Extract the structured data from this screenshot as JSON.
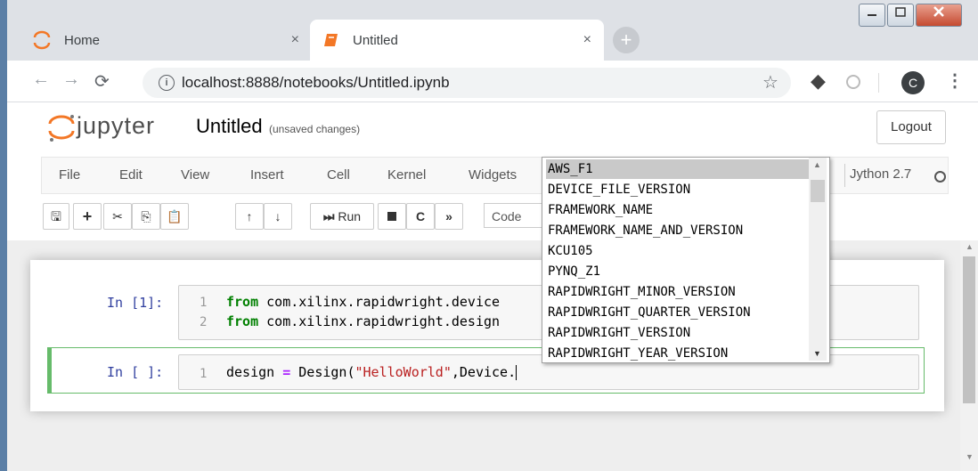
{
  "browser": {
    "tabs": [
      {
        "label": "Home",
        "close": "×"
      },
      {
        "label": "Untitled",
        "close": "×"
      }
    ],
    "new_tab": "+",
    "url": "localhost:8888/notebooks/Untitled.ipynb",
    "profile_initial": "C"
  },
  "jupyter": {
    "logo_text": "jupyter",
    "notebook_title": "Untitled",
    "save_status": "(unsaved changes)",
    "logout_label": "Logout",
    "menu": [
      "File",
      "Edit",
      "View",
      "Insert",
      "Cell",
      "Kernel",
      "Widgets"
    ],
    "kernel": "Jython 2.7",
    "toolbar": {
      "run_label": "Run",
      "cell_type": "Code"
    }
  },
  "cells": [
    {
      "prompt": "In [1]:",
      "lines": [
        {
          "no": "1",
          "kw": "from",
          "rest": " com.xilinx.rapidwright.device"
        },
        {
          "no": "2",
          "kw": "from",
          "rest": " com.xilinx.rapidwright.design"
        }
      ]
    },
    {
      "prompt": "In [ ]:",
      "lines": [
        {
          "no": "1",
          "pre": "design ",
          "op": "=",
          "mid": " Design(",
          "str": "\"HelloWorld\"",
          "post": ",Device."
        }
      ]
    }
  ],
  "completions": {
    "items": [
      "AWS_F1",
      "DEVICE_FILE_VERSION",
      "FRAMEWORK_NAME",
      "FRAMEWORK_NAME_AND_VERSION",
      "KCU105",
      "PYNQ_Z1",
      "RAPIDWRIGHT_MINOR_VERSION",
      "RAPIDWRIGHT_QUARTER_VERSION",
      "RAPIDWRIGHT_VERSION",
      "RAPIDWRIGHT_YEAR_VERSION"
    ],
    "selected_index": 0
  }
}
